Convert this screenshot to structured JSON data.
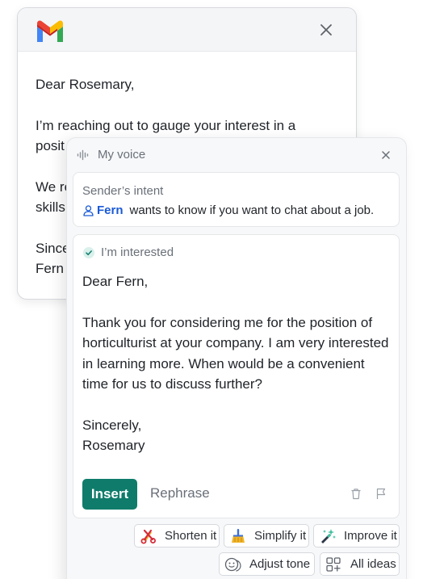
{
  "email": {
    "greeting": "Dear Rosemary,",
    "line1": "I’m reaching out to gauge your interest in a",
    "line2": "posit",
    "line3": "We re",
    "line4": "skills",
    "signoff": "Since",
    "signature": "Fern"
  },
  "panel": {
    "title": "My voice",
    "intent": {
      "label": "Sender’s intent",
      "name": "Fern",
      "text": "wants to know if you want to chat about a job."
    },
    "reply": {
      "label": "I’m interested",
      "greeting": "Dear Fern,",
      "body": "Thank you for considering me for the position of horticulturist at your company. I am very interested in learning more. When would be a convenient time for us to discuss further?",
      "signoff": "Sincerely,",
      "signature": "Rosemary",
      "insert_label": "Insert",
      "rephrase_label": "Rephrase"
    },
    "actions": {
      "shorten": "Shorten it",
      "simplify": "Simplify it",
      "improve": "Improve it",
      "tone": "Adjust tone",
      "ideas": "All ideas"
    }
  },
  "colors": {
    "accent_green": "#0f7c6b",
    "sender_blue": "#1a5ad7",
    "muted_text": "#6a7079"
  },
  "icons": [
    "gmail-logo",
    "close-icon",
    "voice-icon",
    "person-icon",
    "check-circle-icon",
    "trash-icon",
    "flag-icon",
    "scissors-icon",
    "broom-icon",
    "magic-wand-icon",
    "face-icon",
    "grid-icon"
  ]
}
